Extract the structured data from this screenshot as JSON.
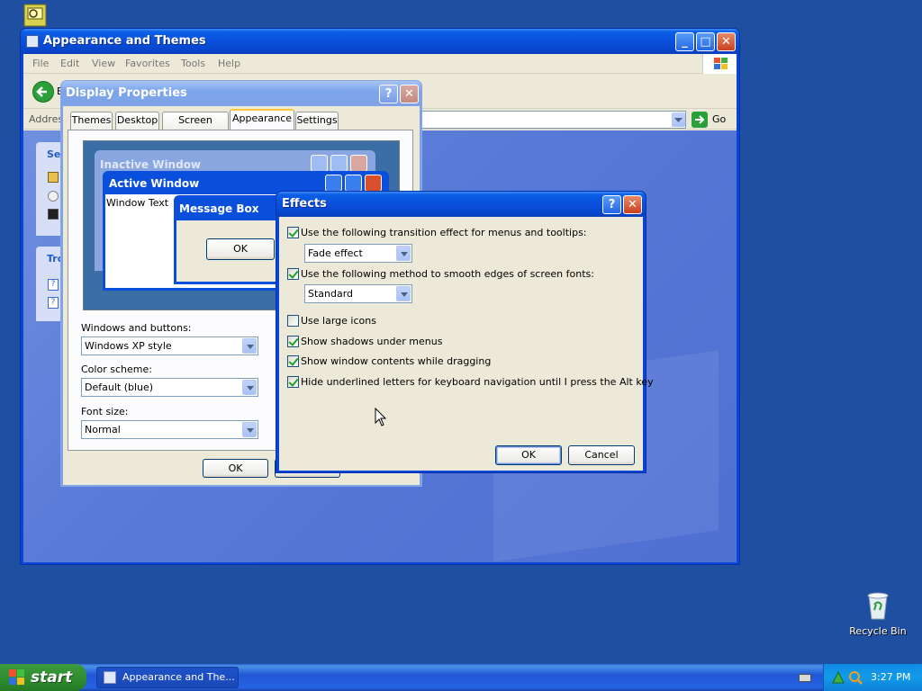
{
  "desktop": {
    "recycle_bin_label": "Recycle Bin",
    "top_icon_name": "network-icon"
  },
  "explorer": {
    "title": "Appearance and Themes",
    "menu": [
      "File",
      "Edit",
      "View",
      "Favorites",
      "Tools",
      "Help"
    ],
    "back_label": "B",
    "address_label": "Address",
    "go_label": "Go",
    "side_panel_1_title": "Se",
    "side_panel_2_title": "Tro"
  },
  "display_properties": {
    "title": "Display Properties",
    "tabs": [
      "Themes",
      "Desktop",
      "Screen Saver",
      "Appearance",
      "Settings"
    ],
    "active_tab": "Appearance",
    "preview": {
      "inactive_title": "Inactive Window",
      "active_title": "Active Window",
      "window_text": "Window Text",
      "message_box_title": "Message Box",
      "message_ok": "OK"
    },
    "windows_buttons_label": "Windows and buttons:",
    "windows_buttons_value": "Windows XP style",
    "color_scheme_label": "Color scheme:",
    "color_scheme_value": "Default (blue)",
    "font_size_label": "Font size:",
    "font_size_value": "Normal",
    "ok_label": "OK"
  },
  "effects": {
    "title": "Effects",
    "transition_label": "Use the following transition effect for menus and tooltips:",
    "transition_checked": true,
    "transition_value": "Fade effect",
    "smooth_label": "Use the following method to smooth edges of screen fonts:",
    "smooth_checked": true,
    "smooth_value": "Standard",
    "large_icons_label": "Use large icons",
    "large_icons_checked": false,
    "shadows_label": "Show shadows under menus",
    "shadows_checked": true,
    "drag_label": "Show window contents while dragging",
    "drag_checked": true,
    "underline_label": "Hide underlined letters for keyboard navigation until I press the Alt key",
    "underline_checked": true,
    "ok_label": "OK",
    "cancel_label": "Cancel"
  },
  "taskbar": {
    "start_label": "start",
    "task_label": "Appearance and The...",
    "clock": "3:27 PM"
  },
  "colors": {
    "desktop": "#1f4fa0",
    "xp_blue_title": "#0a4fdc",
    "dialog_face": "#ece9d8",
    "start_green": "#308f30"
  }
}
